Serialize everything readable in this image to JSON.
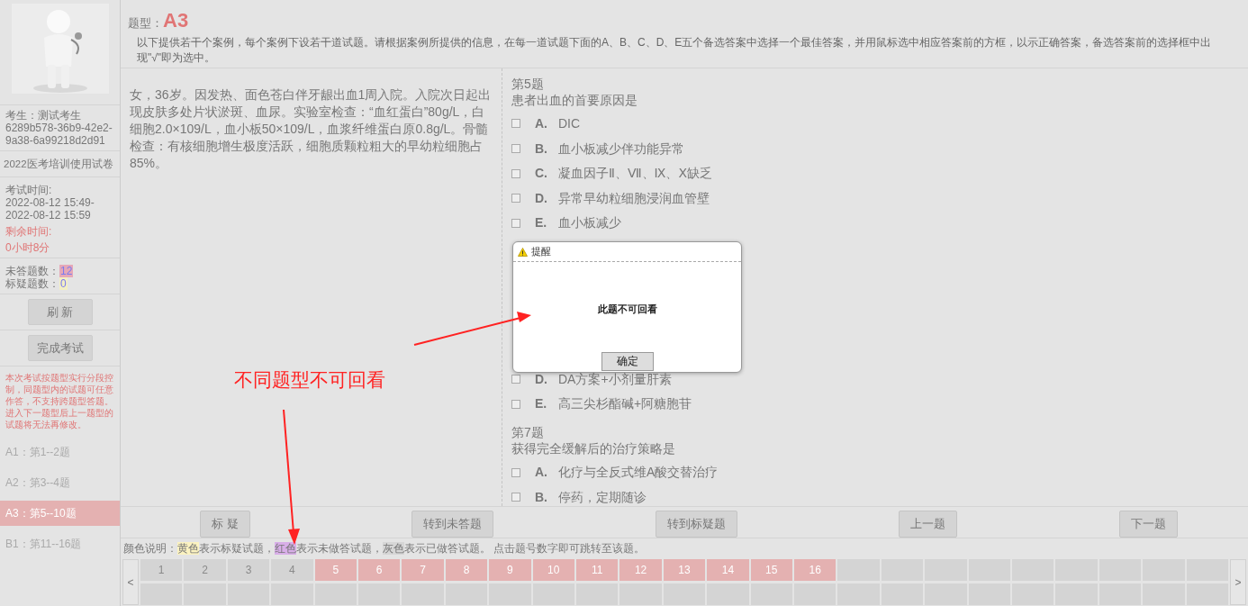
{
  "sidebar": {
    "candidate": "考生：测试考生",
    "candidate_id": "6289b578-36b9-42e2-9a38-6a99218d2d91",
    "paper": "2022医考培训使用试卷",
    "exam_time_label": "考试时间:",
    "exam_time_start": "2022-08-12 15:49-",
    "exam_time_end": "2022-08-12 15:59",
    "remaining_label": "剩余时间:",
    "remaining": "0小时8分",
    "counts": [
      {
        "label": "未答题数：",
        "value": "12",
        "color": "#e6a8b8"
      },
      {
        "label": "标疑题数：",
        "value": "0",
        "color": "#f3efc4"
      }
    ],
    "buttons": [
      "刷 新",
      "完成考试"
    ],
    "notice": "本次考试按题型实行分段控制，同题型内的试题可任意作答，不支持跨题型答题。进入下一题型后上一题型的试题将无法再修改。",
    "sections": [
      {
        "label": "A1：第1--2题",
        "selected": false
      },
      {
        "label": "A2：第3--4题",
        "selected": false
      },
      {
        "label": "A3：第5--10题",
        "selected": true
      },
      {
        "label": "B1：第11--16题",
        "selected": false
      }
    ]
  },
  "header": {
    "label": "题型：",
    "type": "A3",
    "instructions": "以下提供若干个案例，每个案例下设若干道试题。请根据案例所提供的信息，在每一道试题下面的A、B、C、D、E五个备选答案中选择一个最佳答案，并用鼠标选中相应答案前的方框，以示正确答案，备选答案前的选择框中出现\"√\"即为选中。"
  },
  "case_text": "女，36岁。因发热、面色苍白伴牙龈出血1周入院。入院次日起出现皮肤多处片状淤斑、血尿。实验室检查：“血红蛋白”80g/L，白细胞2.0×109/L，血小板50×109/L，血浆纤维蛋白原0.8g/L。骨髓检查：有核细胞增生极度活跃，细胞质颗粒粗大的早幼粒细胞占85%。",
  "questions": [
    {
      "number": "第5题",
      "stem": "患者出血的首要原因是",
      "options": [
        {
          "letter": "A.",
          "text": "DIC",
          "checked": false
        },
        {
          "letter": "B.",
          "text": "血小板减少伴功能异常",
          "checked": false
        },
        {
          "letter": "C.",
          "text": "凝血因子Ⅱ、Ⅶ、Ⅸ、Ⅹ缺乏",
          "checked": false
        },
        {
          "letter": "D.",
          "text": "异常早幼粒细胞浸润血管壁",
          "checked": false
        },
        {
          "letter": "E.",
          "text": "血小板减少",
          "checked": false
        }
      ]
    },
    {
      "options": [
        {
          "letter": "D.",
          "text": "DA方案+小剂量肝素",
          "checked": false
        },
        {
          "letter": "E.",
          "text": "高三尖杉酯碱+阿糖胞苷",
          "checked": false
        }
      ]
    },
    {
      "number": "第7题",
      "stem": "获得完全缓解后的治疗策略是",
      "options": [
        {
          "letter": "A.",
          "text": "化疗与全反式维A酸交替治疗",
          "checked": false
        },
        {
          "letter": "B.",
          "text": "停药，定期随诊",
          "checked": false
        }
      ]
    }
  ],
  "action_buttons": [
    "标 疑",
    "转到未答题",
    "转到标疑题",
    "上一题",
    "下一题"
  ],
  "legend": [
    {
      "text": "颜色说明："
    },
    {
      "text": "黄色",
      "color": "#fbf2c0"
    },
    {
      "text": "表示标疑试题，"
    },
    {
      "text": "红色",
      "color": "#d8aee8"
    },
    {
      "text": "表示未做答试题，"
    },
    {
      "text": "灰色",
      "color": "#d6d6d6"
    },
    {
      "text": "表示已做答试题。 点击题号数字即可跳转至该题。"
    }
  ],
  "nav": {
    "prev": "<",
    "next": ">",
    "cells": [
      {
        "label": "1",
        "answered": true
      },
      {
        "label": "2",
        "answered": true
      },
      {
        "label": "3",
        "answered": true
      },
      {
        "label": "4",
        "answered": true
      },
      {
        "label": "5",
        "answered": false
      },
      {
        "label": "6",
        "answered": false
      },
      {
        "label": "7",
        "answered": false
      },
      {
        "label": "8",
        "answered": false
      },
      {
        "label": "9",
        "answered": false
      },
      {
        "label": "10",
        "answered": false
      },
      {
        "label": "11",
        "answered": false
      },
      {
        "label": "12",
        "answered": false
      },
      {
        "label": "13",
        "answered": false
      },
      {
        "label": "14",
        "answered": false
      },
      {
        "label": "15",
        "answered": false
      },
      {
        "label": "16",
        "answered": false
      }
    ]
  },
  "dialog": {
    "title": "提醒",
    "message": "此题不可回看",
    "button": "确定"
  },
  "annotation": {
    "text": "不同题型不可回看"
  }
}
